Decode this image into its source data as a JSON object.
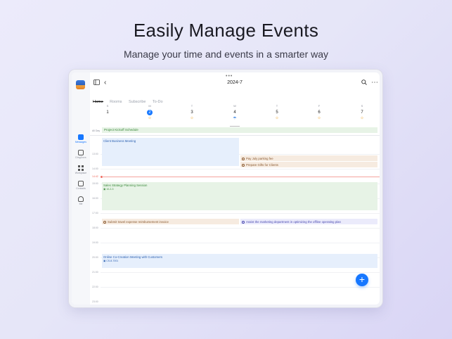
{
  "promo": {
    "headline": "Easily Manage Events",
    "subline": "Manage your time and events in a smarter way"
  },
  "sidebar": {
    "items": [
      {
        "label": "Messages",
        "icon": "messages-icon"
      },
      {
        "label": "DingDocs",
        "icon": "docs-icon"
      },
      {
        "label": "Workplace",
        "icon": "workplace-icon"
      },
      {
        "label": "Contacts",
        "icon": "contacts-icon"
      },
      {
        "label": "Me",
        "icon": "profile-icon"
      }
    ]
  },
  "toolbar": {
    "title": "2024-7",
    "topdots": "•••",
    "back_glyph": "‹",
    "search_glyph": "⌕",
    "more_glyph": "⋯"
  },
  "tabs": [
    {
      "label": "Home",
      "active": true
    },
    {
      "label": "Rooms",
      "active": false
    },
    {
      "label": "Subscribe",
      "active": false
    },
    {
      "label": "To-Do",
      "active": false
    }
  ],
  "week": [
    {
      "dn": "S",
      "dd": "1",
      "wx": ""
    },
    {
      "dn": "M",
      "dd": "2",
      "wx": "☼",
      "today": true
    },
    {
      "dn": "T",
      "dd": "3",
      "wx": "☼"
    },
    {
      "dn": "W",
      "dd": "4",
      "wx": "☂",
      "rain": true
    },
    {
      "dn": "T",
      "dd": "5",
      "wx": "☼"
    },
    {
      "dn": "F",
      "dd": "6",
      "wx": "☼"
    },
    {
      "dn": "S",
      "dd": "7",
      "wx": "☼"
    }
  ],
  "allday": {
    "label": "All Day",
    "event": "Project Kickoff Schedule"
  },
  "hours": [
    "13:00",
    "14:00",
    "15:00",
    "16:00",
    "17:00",
    "18:00",
    "19:00",
    "20:00",
    "21:00",
    "22:00",
    "23:00"
  ],
  "now_label": "14:42",
  "events": {
    "client_meeting": "Client Business Meeting",
    "pay_parking": "Pay July parking fee",
    "prepare_gifts": "Prepare Gifts for Clients",
    "sales_session": "Sales Strategy Planning Session",
    "sales_room": "10-2-3",
    "submit_invoice": "Submit travel expense reimbursement invoice",
    "assist_marketing": "Assist the marketing department in optimizing the offline operating plan",
    "online_meeting": "Online Co-Creation Meeting with Customers",
    "online_room": "CS-8-7001"
  },
  "fab_label": "+",
  "colors": {
    "accent": "#1677ff",
    "now": "#f06a5e"
  }
}
